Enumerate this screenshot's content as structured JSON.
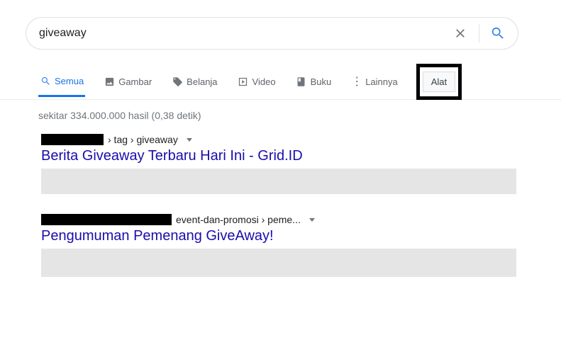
{
  "search": {
    "query": "giveaway"
  },
  "tabs": {
    "all": "Semua",
    "images": "Gambar",
    "shopping": "Belanja",
    "video": "Video",
    "books": "Buku",
    "more": "Lainnya",
    "tools": "Alat"
  },
  "stats": "sekitar 334.000.000 hasil (0,38 detik)",
  "results": [
    {
      "breadcrumb": " › tag › giveaway",
      "title": "Berita Giveaway Terbaru Hari Ini - Grid.ID"
    },
    {
      "breadcrumb": " event-dan-promosi › peme...",
      "title": "Pengumuman Pemenang GiveAway!"
    }
  ]
}
